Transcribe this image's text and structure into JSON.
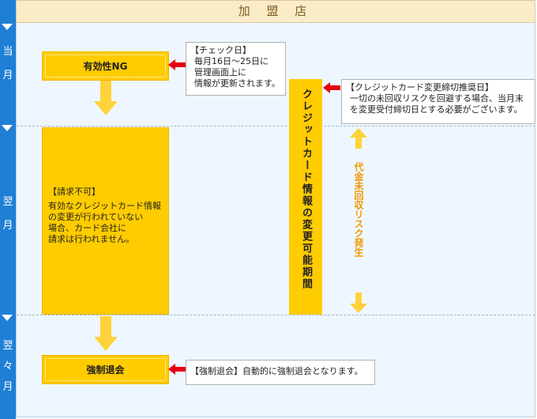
{
  "header": {
    "title": "加 盟 店"
  },
  "timeline": {
    "periods": [
      {
        "label_line1": "当",
        "label_line2": "月"
      },
      {
        "label_line1": "翌",
        "label_line2": "月"
      },
      {
        "label_line1": "翌",
        "label_line2": "々",
        "label_line3": "月"
      }
    ]
  },
  "flow": {
    "validity_ng": "有効性NG",
    "billing_block": {
      "title": "【請求不可】",
      "lines": [
        "有効なクレジットカード情報",
        "の変更が行われていない",
        "場合、カード会社に",
        "請求は行われません。"
      ]
    },
    "forced_withdrawal": "強制退会"
  },
  "notes": {
    "check_day": {
      "title": "【チェック日】",
      "lines": [
        "毎月16日～25日に",
        "管理画面上に",
        "情報が更新されます。"
      ]
    },
    "recommended_deadline": {
      "title": "【クレジットカード変更締切推奨日】",
      "lines": [
        "一切の未回収リスクを回避する場合、当月末",
        "を変更受付締切日とする必要がございます。"
      ]
    },
    "forced_withdrawal_note": "【強制退会】自動的に強制退会となります。"
  },
  "vertical_box": {
    "text": "クレジットカード情報の変更可能期間"
  },
  "risk": {
    "text": "代金未回収リスク発生"
  },
  "colors": {
    "timeline_blue": "#1f7fd6",
    "box_yellow": "#ffcc00",
    "arrow_red": "#e60012",
    "risk_orange": "#f39800",
    "arrow_yellow": "#ffd23a"
  }
}
